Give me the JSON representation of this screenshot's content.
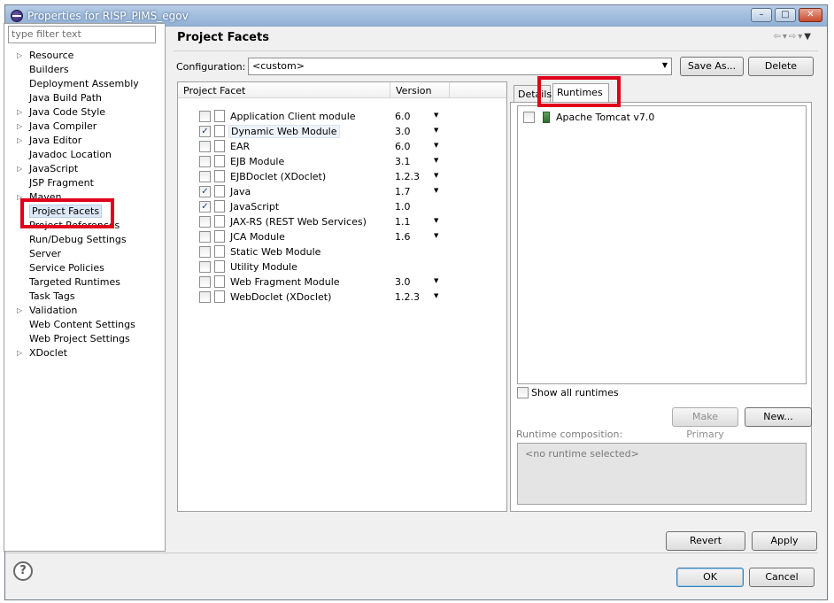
{
  "window": {
    "title": "Properties for RISP_PIMS_egov"
  },
  "filter": {
    "placeholder": "type filter text"
  },
  "nav": {
    "items": [
      {
        "label": "Resource",
        "expandable": true
      },
      {
        "label": "Builders",
        "expandable": false
      },
      {
        "label": "Deployment Assembly",
        "expandable": false
      },
      {
        "label": "Java Build Path",
        "expandable": false
      },
      {
        "label": "Java Code Style",
        "expandable": true
      },
      {
        "label": "Java Compiler",
        "expandable": true
      },
      {
        "label": "Java Editor",
        "expandable": true
      },
      {
        "label": "Javadoc Location",
        "expandable": false
      },
      {
        "label": "JavaScript",
        "expandable": true
      },
      {
        "label": "JSP Fragment",
        "expandable": false
      },
      {
        "label": "Maven",
        "expandable": true
      },
      {
        "label": "Project Facets",
        "expandable": false,
        "selected": true
      },
      {
        "label": "Project References",
        "expandable": false
      },
      {
        "label": "Run/Debug Settings",
        "expandable": false
      },
      {
        "label": "Server",
        "expandable": false
      },
      {
        "label": "Service Policies",
        "expandable": false
      },
      {
        "label": "Targeted Runtimes",
        "expandable": false
      },
      {
        "label": "Task Tags",
        "expandable": false
      },
      {
        "label": "Validation",
        "expandable": true
      },
      {
        "label": "Web Content Settings",
        "expandable": false
      },
      {
        "label": "Web Project Settings",
        "expandable": false
      },
      {
        "label": "XDoclet",
        "expandable": true
      }
    ]
  },
  "page": {
    "title": "Project Facets"
  },
  "config": {
    "label": "Configuration:",
    "value": "<custom>",
    "save_as": "Save As...",
    "delete": "Delete"
  },
  "facets": {
    "col_facet": "Project Facet",
    "col_version": "Version",
    "rows": [
      {
        "name": "Application Client module",
        "checked": false,
        "version": "6.0",
        "dropdown": true,
        "icon": "document-icon"
      },
      {
        "name": "Dynamic Web Module",
        "checked": true,
        "version": "3.0",
        "dropdown": true,
        "icon": "globe-document-icon"
      },
      {
        "name": "EAR",
        "checked": false,
        "version": "6.0",
        "dropdown": true,
        "icon": "document-icon"
      },
      {
        "name": "EJB Module",
        "checked": false,
        "version": "3.1",
        "dropdown": true,
        "icon": "bean-document-icon"
      },
      {
        "name": "EJBDoclet (XDoclet)",
        "checked": false,
        "version": "1.2.3",
        "dropdown": true,
        "icon": "document-icon"
      },
      {
        "name": "Java",
        "checked": true,
        "version": "1.7",
        "dropdown": true,
        "icon": "java-icon"
      },
      {
        "name": "JavaScript",
        "checked": true,
        "version": "1.0",
        "dropdown": false,
        "icon": "javascript-icon"
      },
      {
        "name": "JAX-RS (REST Web Services)",
        "checked": false,
        "version": "1.1",
        "dropdown": true,
        "icon": "document-icon"
      },
      {
        "name": "JCA Module",
        "checked": false,
        "version": "1.6",
        "dropdown": true,
        "icon": "document-icon"
      },
      {
        "name": "Static Web Module",
        "checked": false,
        "version": "",
        "dropdown": false,
        "icon": "document-icon"
      },
      {
        "name": "Utility Module",
        "checked": false,
        "version": "",
        "dropdown": false,
        "icon": "document-icon"
      },
      {
        "name": "Web Fragment Module",
        "checked": false,
        "version": "3.0",
        "dropdown": true,
        "icon": "document-icon"
      },
      {
        "name": "WebDoclet (XDoclet)",
        "checked": false,
        "version": "1.2.3",
        "dropdown": true,
        "icon": "document-icon"
      }
    ]
  },
  "tabs": {
    "details": "Details",
    "runtimes": "Runtimes"
  },
  "runtimes": {
    "items": [
      {
        "name": "Apache Tomcat v7.0",
        "checked": false
      }
    ],
    "show_all": "Show all runtimes",
    "make_primary": "Make Primary",
    "new": "New...",
    "composition_label": "Runtime composition:",
    "composition_value": "<no runtime selected>"
  },
  "buttons": {
    "revert": "Revert",
    "apply": "Apply",
    "ok": "OK",
    "cancel": "Cancel"
  },
  "help": {
    "glyph": "?"
  },
  "colors": {
    "highlight_box": "#e0001a",
    "selection": "#dde8f6"
  }
}
